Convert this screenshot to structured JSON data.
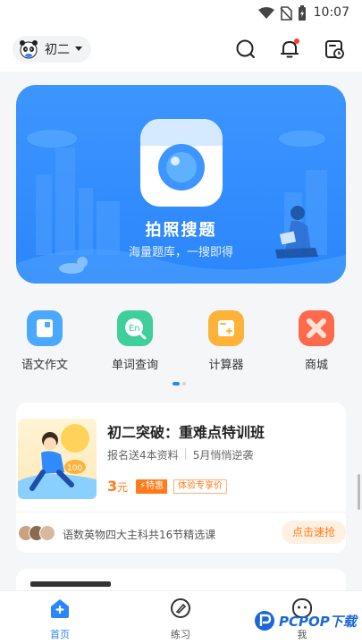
{
  "status_bar": {
    "time": "10:07"
  },
  "header": {
    "grade_label": "初二"
  },
  "hero": {
    "title": "拍照搜题",
    "subtitle": "海量题库，一搜即得",
    "bg_color": "#2b86fb"
  },
  "quick_actions": [
    {
      "label": "语文作文",
      "icon": "essay-icon",
      "color": "#4aa8ff"
    },
    {
      "label": "单词查询",
      "icon": "word-search-icon",
      "color": "#3fcf9c"
    },
    {
      "label": "计算器",
      "icon": "calculator-icon",
      "color": "#ffb238"
    },
    {
      "label": "商城",
      "icon": "mall-icon",
      "color": "#ff6a4d"
    }
  ],
  "course_card": {
    "title": "初二突破：重难点特训班",
    "meta_left": "报名送4本资料",
    "meta_sep": "|",
    "meta_right": "5月悄悄逆袭",
    "price": "3",
    "price_unit": "元",
    "tag_special": "⚡特惠",
    "tag_experience": "体验专享价",
    "promo_text": "语数英物四大主科共16节精选课",
    "cta_label": "点击速抢",
    "accent_color": "#ff7a1a"
  },
  "tabbar": {
    "items": [
      {
        "label": "首页",
        "icon": "home-icon",
        "active": true
      },
      {
        "label": "练习",
        "icon": "practice-icon",
        "active": false
      },
      {
        "label": "我",
        "icon": "profile-icon",
        "active": false
      }
    ]
  },
  "watermark": {
    "text": "PCPOP下载"
  }
}
